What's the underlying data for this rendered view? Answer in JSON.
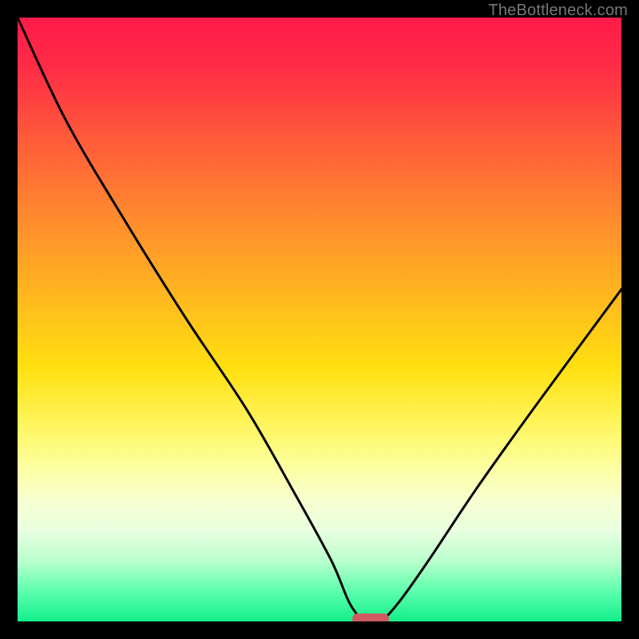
{
  "watermark": "TheBottleneck.com",
  "colors": {
    "background": "#000000",
    "marker": "#cf5b63",
    "curve": "#000000"
  },
  "chart_data": {
    "type": "line",
    "title": "",
    "xlabel": "",
    "ylabel": "",
    "xlim": [
      0,
      100
    ],
    "ylim": [
      0,
      100
    ],
    "grid": false,
    "series": [
      {
        "name": "bottleneck-curve",
        "x": [
          0,
          8,
          18,
          28,
          38,
          46,
          52,
          55,
          57.5,
          60,
          63,
          68,
          76,
          86,
          100
        ],
        "values": [
          100,
          83,
          66,
          50,
          35,
          21,
          10,
          3,
          0,
          0,
          3,
          10,
          22,
          36,
          55
        ]
      }
    ],
    "annotations": [
      {
        "kind": "marker-pill",
        "x": 58.5,
        "y": 0
      }
    ]
  }
}
